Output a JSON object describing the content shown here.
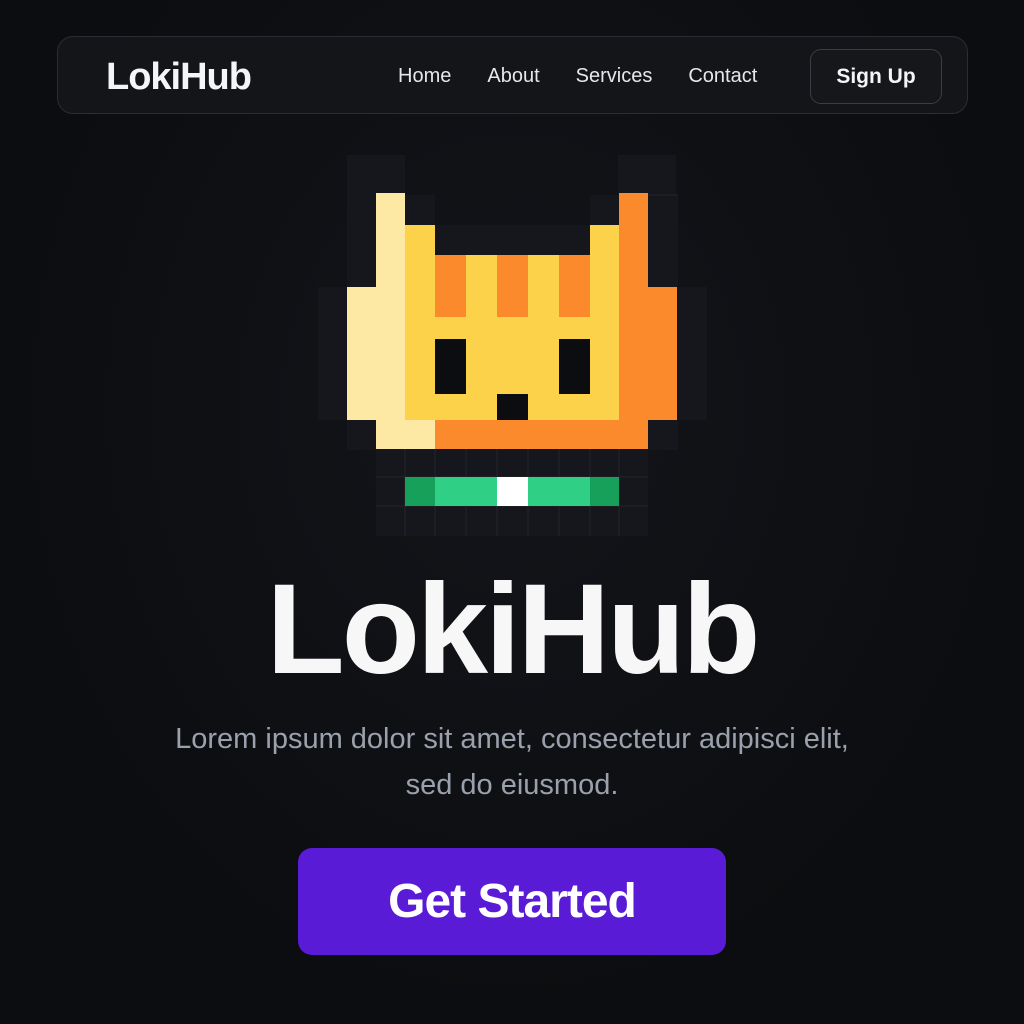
{
  "navbar": {
    "brand": "LokiHub",
    "links": [
      "Home",
      "About",
      "Services",
      "Contact"
    ],
    "signup_label": "Sign Up"
  },
  "hero": {
    "mascot_icon": "pixel-cat-icon",
    "title": "LokiHub",
    "subtitle": "Lorem ipsum dolor sit amet, consectetur adipisci elit, sed do eiusmod.",
    "cta_label": "Get Started"
  },
  "colors": {
    "background": "#0c0d10",
    "navbar_bg": "#131519",
    "cta": "#5a1bd6",
    "cat_yellow": "#fdd24b",
    "cat_orange": "#fb8a2c",
    "cat_light": "#fde9a4",
    "collar_green": "#2fcf85",
    "collar_dark_green": "#16a05a"
  }
}
